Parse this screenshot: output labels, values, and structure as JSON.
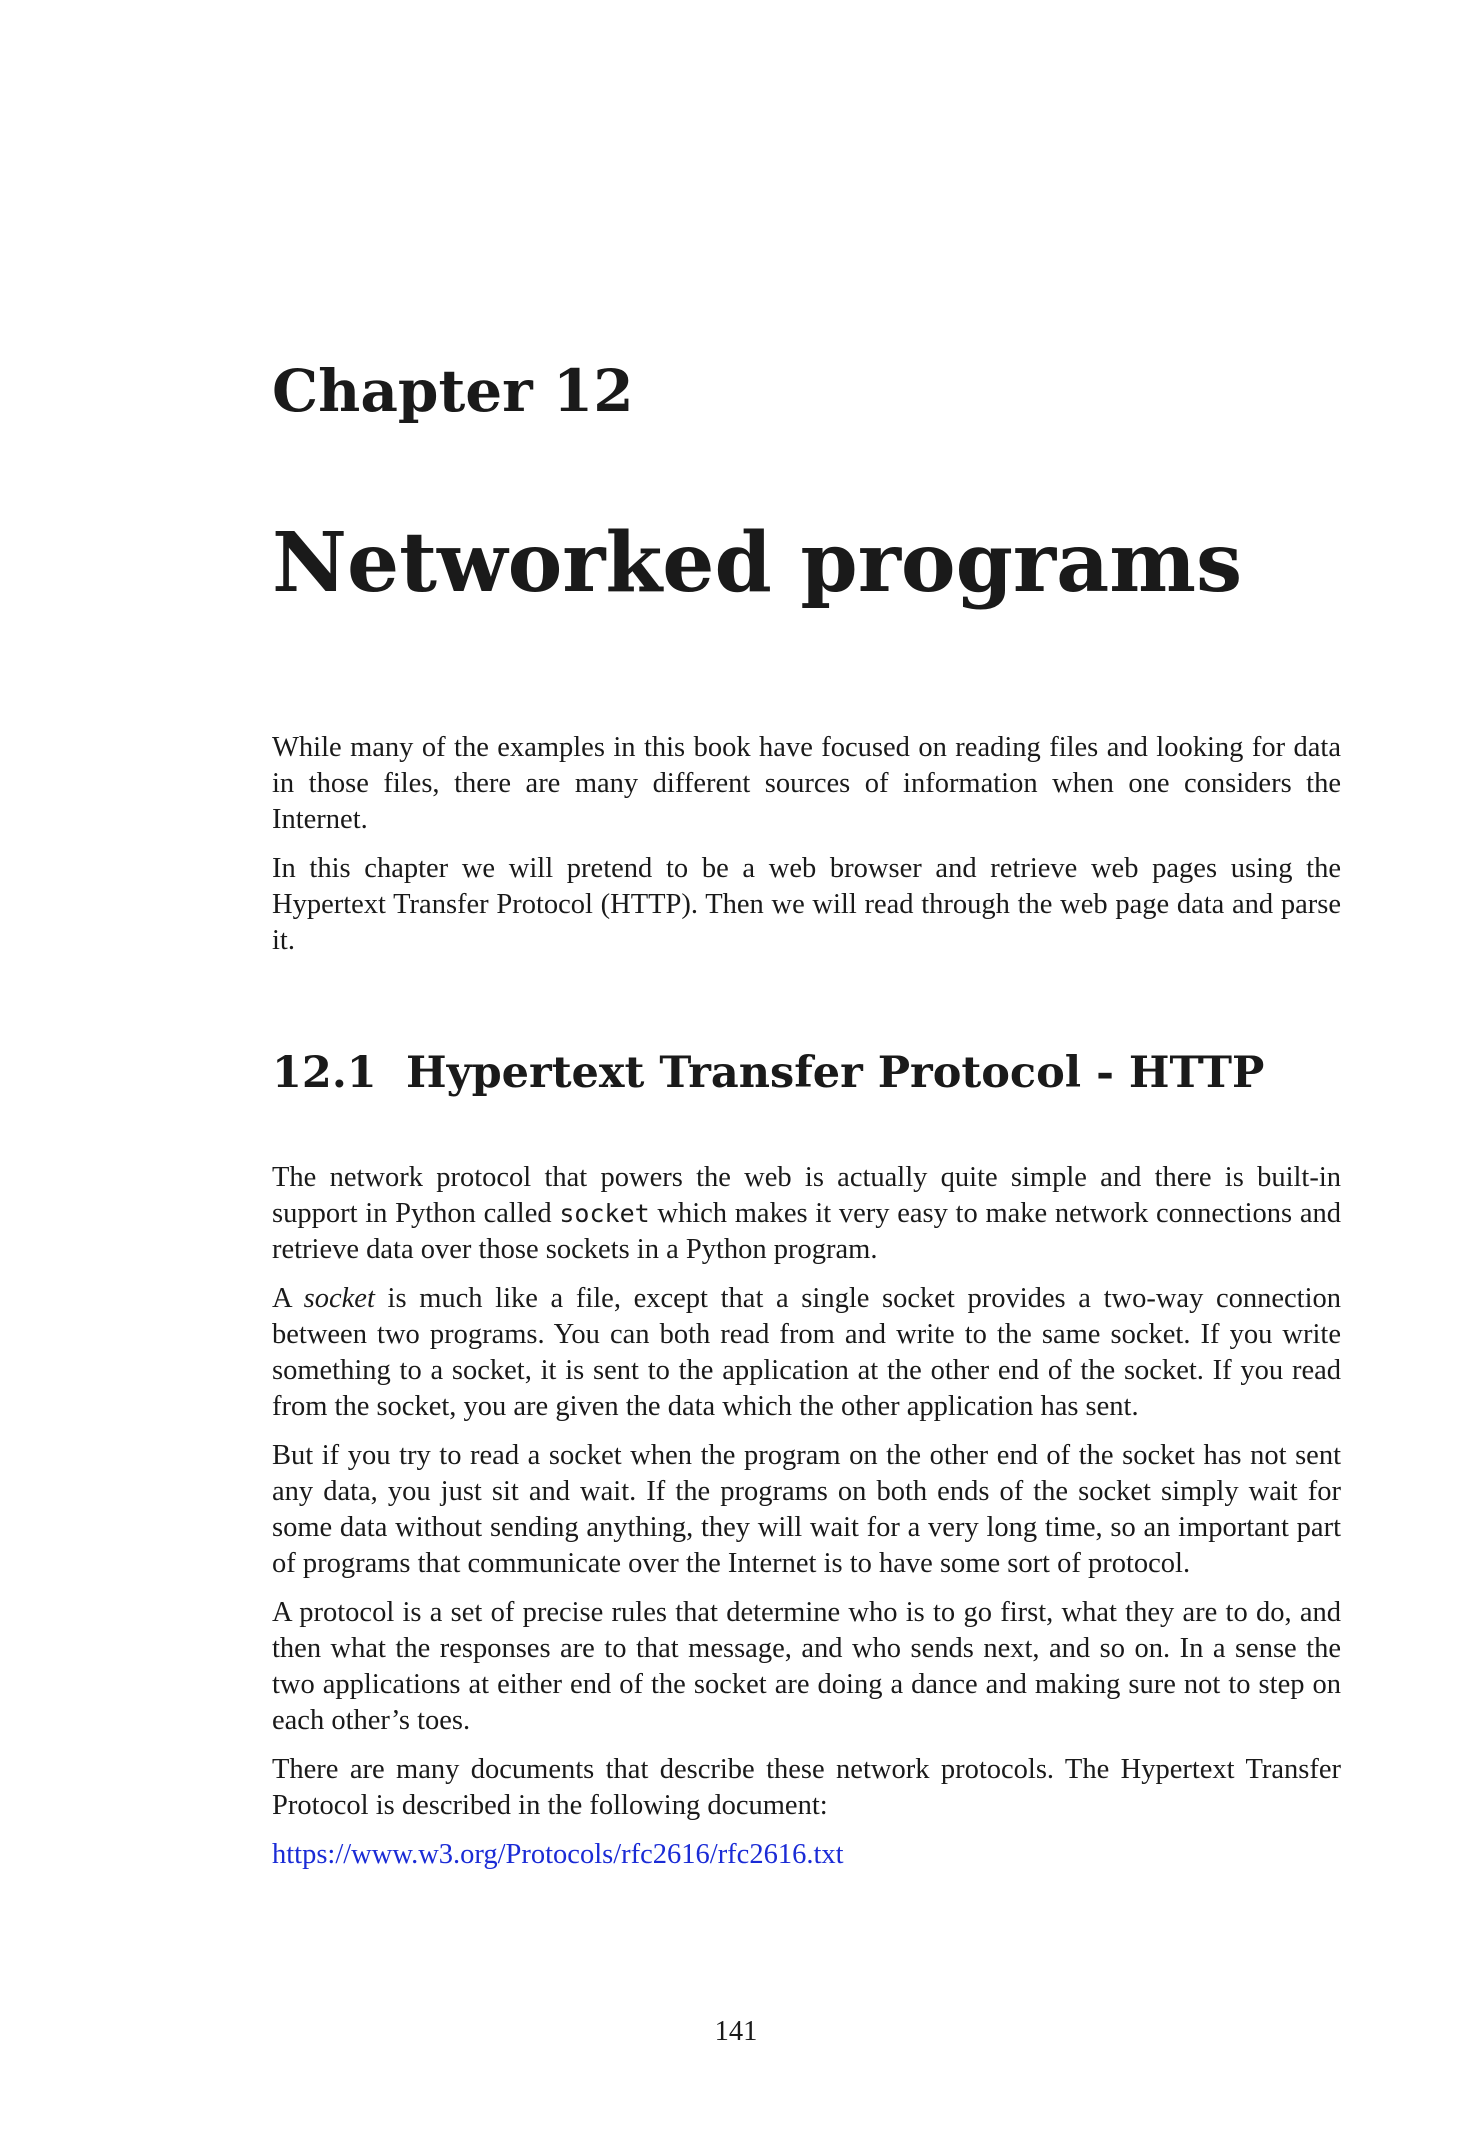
{
  "chapter": {
    "label": "Chapter 12",
    "title": "Networked programs"
  },
  "intro": {
    "paragraphs": [
      "While many of the examples in this book have focused on reading files and looking for data in those files, there are many different sources of information when one considers the Internet.",
      "In this chapter we will pretend to be a web browser and retrieve web pages using the Hypertext Transfer Protocol (HTTP). Then we will read through the web page data and parse it."
    ]
  },
  "section": {
    "number": "12.1",
    "title": "Hypertext Transfer Protocol - HTTP",
    "p1_before": "The network protocol that powers the web is actually quite simple and there is built-in support in Python called ",
    "p1_code": "socket",
    "p1_after": " which makes it very easy to make network connections and retrieve data over those sockets in a Python program.",
    "p2_before": "A ",
    "p2_em": "socket",
    "p2_after": " is much like a file, except that a single socket provides a two-way connection between two programs. You can both read from and write to the same socket. If you write something to a socket, it is sent to the application at the other end of the socket. If you read from the socket, you are given the data which the other application has sent.",
    "p3": "But if you try to read a socket when the program on the other end of the socket has not sent any data, you just sit and wait. If the programs on both ends of the socket simply wait for some data without sending anything, they will wait for a very long time, so an important part of programs that communicate over the Internet is to have some sort of protocol.",
    "p4": "A protocol is a set of precise rules that determine who is to go first, what they are to do, and then what the responses are to that message, and who sends next, and so on. In a sense the two applications at either end of the socket are doing a dance and making sure not to step on each other’s toes.",
    "p5": "There are many documents that describe these network protocols. The Hypertext Transfer Protocol is described in the following document:",
    "link": "https://www.w3.org/Protocols/rfc2616/rfc2616.txt"
  },
  "footer": {
    "page_number": "141"
  },
  "colors": {
    "text": "#1a1a1a",
    "link": "#1a2bd6",
    "background": "#ffffff"
  }
}
